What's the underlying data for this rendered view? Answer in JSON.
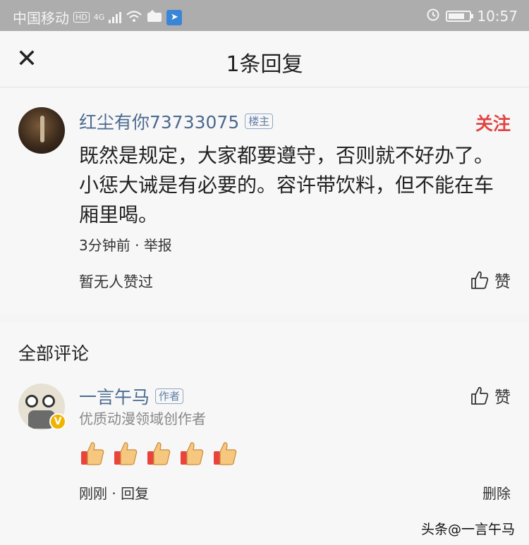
{
  "status_bar": {
    "carrier": "中国移动",
    "hd": "HD",
    "network": "4G",
    "time": "10:57"
  },
  "header": {
    "title": "1条回复",
    "close_icon": "close-icon"
  },
  "post": {
    "username": "红尘有你73733075",
    "badge": "楼主",
    "follow_label": "关注",
    "text": "既然是规定，大家都要遵守，否则就不好办了。小惩大诫是有必要的。容许带饮料，但不能在车厢里喝。",
    "time": "3分钟前",
    "report": "举报",
    "meta_separator": " · ",
    "likes_text": "暂无人赞过",
    "like_label": "赞"
  },
  "comments_section": {
    "title": "全部评论",
    "comment": {
      "author": "一言午马",
      "badge": "作者",
      "description": "优质动漫领域创作者",
      "emoji_count": 5,
      "emoji_icon": "thumbs-up-emoji-icon",
      "like_label": "赞",
      "time": "刚刚",
      "reply": "回复",
      "separator": " · ",
      "delete": "删除"
    }
  },
  "watermark": "头条@一言午马",
  "colors": {
    "status_bar": "#adadad",
    "link_blue": "#4a6a8f",
    "follow_red": "#e04545",
    "verified_badge": "#f0b400"
  }
}
